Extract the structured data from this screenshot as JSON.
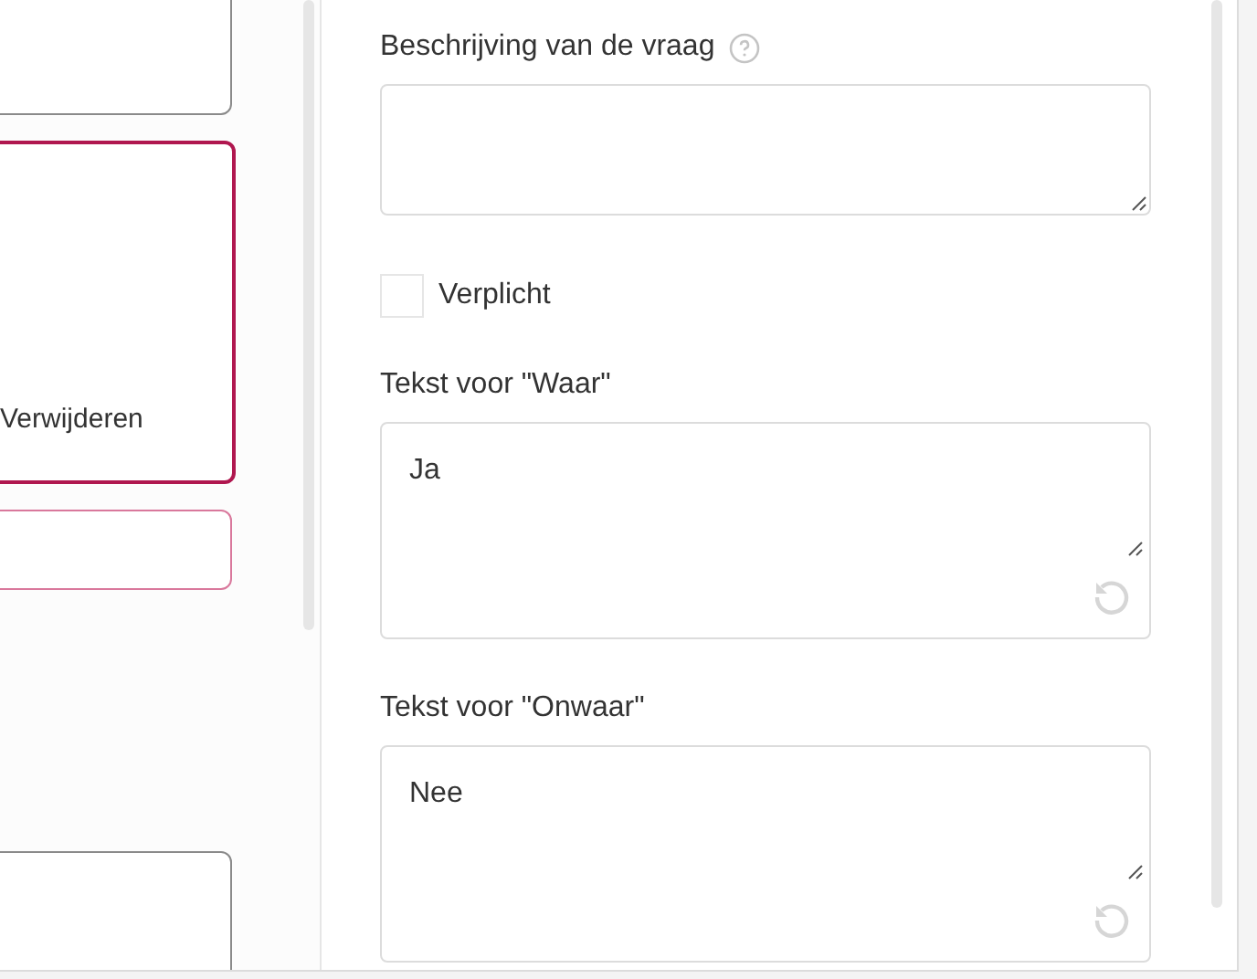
{
  "left_cards": [
    {
      "kind": "plain"
    },
    {
      "kind": "selected",
      "action": "Verwijderen"
    },
    {
      "kind": "outlined"
    },
    {
      "kind": "plain"
    }
  ],
  "description": {
    "label": "Beschrijving van de vraag"
  },
  "required": {
    "label": "Verplicht",
    "checked": false
  },
  "answers": [
    {
      "label": "Tekst voor \"Waar\"",
      "value": "Ja"
    },
    {
      "label": "Tekst voor \"Onwaar\"",
      "value": "Nee"
    }
  ]
}
